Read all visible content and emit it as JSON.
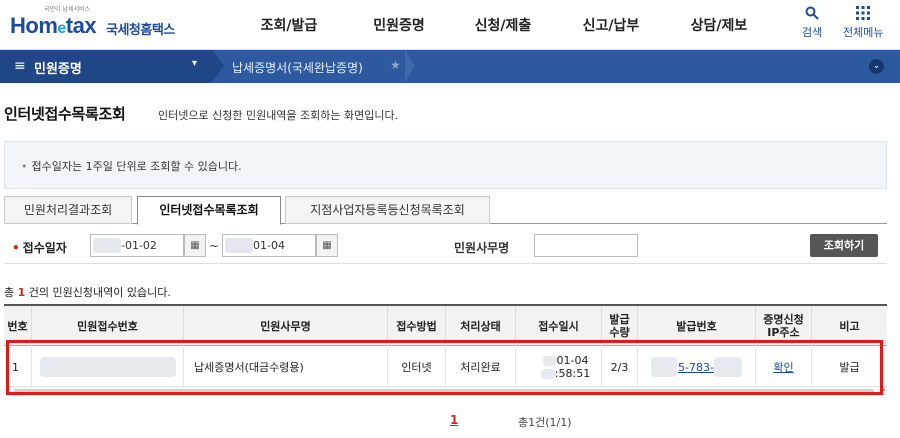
{
  "header": {
    "logo_small": "국민이 납세서비스",
    "logo_main": "Hom",
    "logo_e": "e",
    "logo_tax": "tax",
    "logo_nts": "국세청홈택스",
    "nav": [
      "조회/발급",
      "민원증명",
      "신청/제출",
      "신고/납부",
      "상담/제보"
    ],
    "search_label": "검색",
    "allmenu_label": "전체메뉴",
    "search_icon": "search-icon",
    "allmenu_icon": "grid-icon"
  },
  "navbar": {
    "menu_icon": "≡",
    "menu_label": "민원증명",
    "breadcrumb": "납세증명서(국세완납증명)",
    "star": "★",
    "dropdown": "▾",
    "expand": "⌄"
  },
  "page": {
    "title": "인터넷접수목록조회",
    "subtitle": "인터넷으로 신청한 민원내역을 조회하는 화면입니다.",
    "info": "접수일자는 1주일 단위로 조회할 수 있습니다."
  },
  "tabs": [
    "민원처리결과조회",
    "인터넷접수목록조회",
    "지점사업자등록등신청목록조회"
  ],
  "search": {
    "date_label": "접수일자",
    "date_from": "-01-02",
    "date_to": "01-04",
    "tilde": "~",
    "office_label": "민원사무명",
    "office_value": "",
    "submit": "조회하기"
  },
  "result": {
    "prefix": "총 ",
    "count": "1",
    "suffix": " 건의 민원신청내역이 있습니다."
  },
  "table": {
    "headers": [
      "번호",
      "민원접수번호",
      "민원사무명",
      "접수방법",
      "처리상태",
      "접수일시",
      "발급\n수량",
      "발급번호",
      "증명신청\nIP주소",
      "비고"
    ],
    "rows": [
      {
        "no": "1",
        "receipt_no": "",
        "name": "납세증명서(대금수령용)",
        "method": "인터넷",
        "status": "처리완료",
        "date_line1": "01-04",
        "date_line2": ":58:51",
        "qty": "2/3",
        "issue_no": "5-783-",
        "ip": "확인",
        "note": "발급"
      }
    ]
  },
  "pager": {
    "current": "1",
    "total": "총1건(1/1)"
  },
  "colors": {
    "brand": "#1e4c9a",
    "navbar": "#2d5a9e",
    "highlight": "#e01a1a"
  }
}
